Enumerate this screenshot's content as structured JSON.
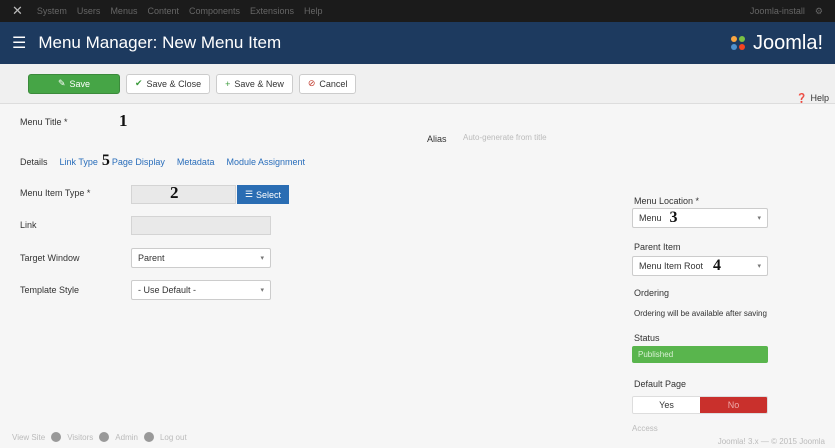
{
  "topbar": {
    "menu": [
      "System",
      "Users",
      "Menus",
      "Content",
      "Components",
      "Extensions",
      "Help"
    ],
    "right_text": "Joomla-install",
    "user_icon": "user-icon"
  },
  "header": {
    "title": "Menu Manager: New Menu Item",
    "brand": "Joomla!"
  },
  "toolbar": {
    "save": "Save",
    "save_close": "Save & Close",
    "save_new": "Save & New",
    "cancel": "Cancel",
    "help": "Help"
  },
  "form": {
    "menu_title_label": "Menu Title *",
    "alias_label": "Alias",
    "alias_placeholder": "Auto-generate from title",
    "menu_item_type_label": "Menu Item Type *",
    "select_button": "Select",
    "link_label": "Link",
    "target_window_label": "Target Window",
    "target_window_value": "Parent",
    "template_style_label": "Template Style",
    "template_style_value": "- Use Default -"
  },
  "tabs": [
    {
      "label": "Details",
      "active": true
    },
    {
      "label": "Link Type",
      "active": false
    },
    {
      "label": "Page Display",
      "active": false
    },
    {
      "label": "Metadata",
      "active": false
    },
    {
      "label": "Module Assignment",
      "active": false
    }
  ],
  "sidebar": {
    "menu_location_label": "Menu Location *",
    "menu_location_value": "Menu",
    "parent_item_label": "Parent Item",
    "parent_item_value": "Menu Item Root",
    "ordering_label": "Ordering",
    "ordering_note": "Ordering will be available after saving",
    "status_label": "Status",
    "status_value": "Published",
    "default_page_label": "Default Page",
    "default_yes": "Yes",
    "default_no": "No",
    "access_label": "Access"
  },
  "annotations": [
    "1",
    "2",
    "3",
    "4",
    "5"
  ],
  "footer": {
    "view_site": "View Site",
    "visitors": "Visitors",
    "admin": "Admin",
    "logout": "Log out",
    "version": "Joomla! 3.x — © 2015 Joomla"
  },
  "colors": {
    "header_bg": "#1d3a5f",
    "save_green": "#46a546",
    "select_blue": "#2a6db3",
    "status_green": "#59b54d",
    "no_red": "#c9302c"
  }
}
